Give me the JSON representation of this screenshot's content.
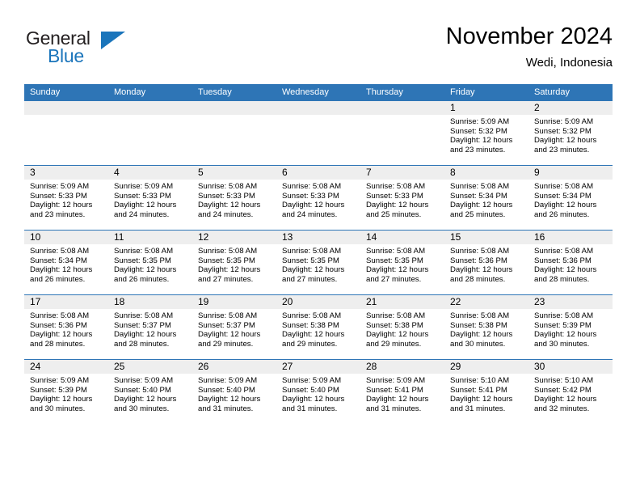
{
  "brand": {
    "name_part1": "General",
    "name_part2": "Blue",
    "triangle_color": "#1b75bb"
  },
  "header": {
    "title": "November 2024",
    "subtitle": "Wedi, Indonesia"
  },
  "theme": {
    "header_blue": "#2e75b6",
    "daynum_band": "#eeeeee",
    "text": "#000000"
  },
  "weekday_headers": [
    "Sunday",
    "Monday",
    "Tuesday",
    "Wednesday",
    "Thursday",
    "Friday",
    "Saturday"
  ],
  "weeks": [
    [
      {
        "day": "",
        "lines": []
      },
      {
        "day": "",
        "lines": []
      },
      {
        "day": "",
        "lines": []
      },
      {
        "day": "",
        "lines": []
      },
      {
        "day": "",
        "lines": []
      },
      {
        "day": "1",
        "lines": [
          "Sunrise: 5:09 AM",
          "Sunset: 5:32 PM",
          "Daylight: 12 hours",
          "and 23 minutes."
        ]
      },
      {
        "day": "2",
        "lines": [
          "Sunrise: 5:09 AM",
          "Sunset: 5:32 PM",
          "Daylight: 12 hours",
          "and 23 minutes."
        ]
      }
    ],
    [
      {
        "day": "3",
        "lines": [
          "Sunrise: 5:09 AM",
          "Sunset: 5:33 PM",
          "Daylight: 12 hours",
          "and 23 minutes."
        ]
      },
      {
        "day": "4",
        "lines": [
          "Sunrise: 5:09 AM",
          "Sunset: 5:33 PM",
          "Daylight: 12 hours",
          "and 24 minutes."
        ]
      },
      {
        "day": "5",
        "lines": [
          "Sunrise: 5:08 AM",
          "Sunset: 5:33 PM",
          "Daylight: 12 hours",
          "and 24 minutes."
        ]
      },
      {
        "day": "6",
        "lines": [
          "Sunrise: 5:08 AM",
          "Sunset: 5:33 PM",
          "Daylight: 12 hours",
          "and 24 minutes."
        ]
      },
      {
        "day": "7",
        "lines": [
          "Sunrise: 5:08 AM",
          "Sunset: 5:33 PM",
          "Daylight: 12 hours",
          "and 25 minutes."
        ]
      },
      {
        "day": "8",
        "lines": [
          "Sunrise: 5:08 AM",
          "Sunset: 5:34 PM",
          "Daylight: 12 hours",
          "and 25 minutes."
        ]
      },
      {
        "day": "9",
        "lines": [
          "Sunrise: 5:08 AM",
          "Sunset: 5:34 PM",
          "Daylight: 12 hours",
          "and 26 minutes."
        ]
      }
    ],
    [
      {
        "day": "10",
        "lines": [
          "Sunrise: 5:08 AM",
          "Sunset: 5:34 PM",
          "Daylight: 12 hours",
          "and 26 minutes."
        ]
      },
      {
        "day": "11",
        "lines": [
          "Sunrise: 5:08 AM",
          "Sunset: 5:35 PM",
          "Daylight: 12 hours",
          "and 26 minutes."
        ]
      },
      {
        "day": "12",
        "lines": [
          "Sunrise: 5:08 AM",
          "Sunset: 5:35 PM",
          "Daylight: 12 hours",
          "and 27 minutes."
        ]
      },
      {
        "day": "13",
        "lines": [
          "Sunrise: 5:08 AM",
          "Sunset: 5:35 PM",
          "Daylight: 12 hours",
          "and 27 minutes."
        ]
      },
      {
        "day": "14",
        "lines": [
          "Sunrise: 5:08 AM",
          "Sunset: 5:35 PM",
          "Daylight: 12 hours",
          "and 27 minutes."
        ]
      },
      {
        "day": "15",
        "lines": [
          "Sunrise: 5:08 AM",
          "Sunset: 5:36 PM",
          "Daylight: 12 hours",
          "and 28 minutes."
        ]
      },
      {
        "day": "16",
        "lines": [
          "Sunrise: 5:08 AM",
          "Sunset: 5:36 PM",
          "Daylight: 12 hours",
          "and 28 minutes."
        ]
      }
    ],
    [
      {
        "day": "17",
        "lines": [
          "Sunrise: 5:08 AM",
          "Sunset: 5:36 PM",
          "Daylight: 12 hours",
          "and 28 minutes."
        ]
      },
      {
        "day": "18",
        "lines": [
          "Sunrise: 5:08 AM",
          "Sunset: 5:37 PM",
          "Daylight: 12 hours",
          "and 28 minutes."
        ]
      },
      {
        "day": "19",
        "lines": [
          "Sunrise: 5:08 AM",
          "Sunset: 5:37 PM",
          "Daylight: 12 hours",
          "and 29 minutes."
        ]
      },
      {
        "day": "20",
        "lines": [
          "Sunrise: 5:08 AM",
          "Sunset: 5:38 PM",
          "Daylight: 12 hours",
          "and 29 minutes."
        ]
      },
      {
        "day": "21",
        "lines": [
          "Sunrise: 5:08 AM",
          "Sunset: 5:38 PM",
          "Daylight: 12 hours",
          "and 29 minutes."
        ]
      },
      {
        "day": "22",
        "lines": [
          "Sunrise: 5:08 AM",
          "Sunset: 5:38 PM",
          "Daylight: 12 hours",
          "and 30 minutes."
        ]
      },
      {
        "day": "23",
        "lines": [
          "Sunrise: 5:08 AM",
          "Sunset: 5:39 PM",
          "Daylight: 12 hours",
          "and 30 minutes."
        ]
      }
    ],
    [
      {
        "day": "24",
        "lines": [
          "Sunrise: 5:09 AM",
          "Sunset: 5:39 PM",
          "Daylight: 12 hours",
          "and 30 minutes."
        ]
      },
      {
        "day": "25",
        "lines": [
          "Sunrise: 5:09 AM",
          "Sunset: 5:40 PM",
          "Daylight: 12 hours",
          "and 30 minutes."
        ]
      },
      {
        "day": "26",
        "lines": [
          "Sunrise: 5:09 AM",
          "Sunset: 5:40 PM",
          "Daylight: 12 hours",
          "and 31 minutes."
        ]
      },
      {
        "day": "27",
        "lines": [
          "Sunrise: 5:09 AM",
          "Sunset: 5:40 PM",
          "Daylight: 12 hours",
          "and 31 minutes."
        ]
      },
      {
        "day": "28",
        "lines": [
          "Sunrise: 5:09 AM",
          "Sunset: 5:41 PM",
          "Daylight: 12 hours",
          "and 31 minutes."
        ]
      },
      {
        "day": "29",
        "lines": [
          "Sunrise: 5:10 AM",
          "Sunset: 5:41 PM",
          "Daylight: 12 hours",
          "and 31 minutes."
        ]
      },
      {
        "day": "30",
        "lines": [
          "Sunrise: 5:10 AM",
          "Sunset: 5:42 PM",
          "Daylight: 12 hours",
          "and 32 minutes."
        ]
      }
    ]
  ]
}
